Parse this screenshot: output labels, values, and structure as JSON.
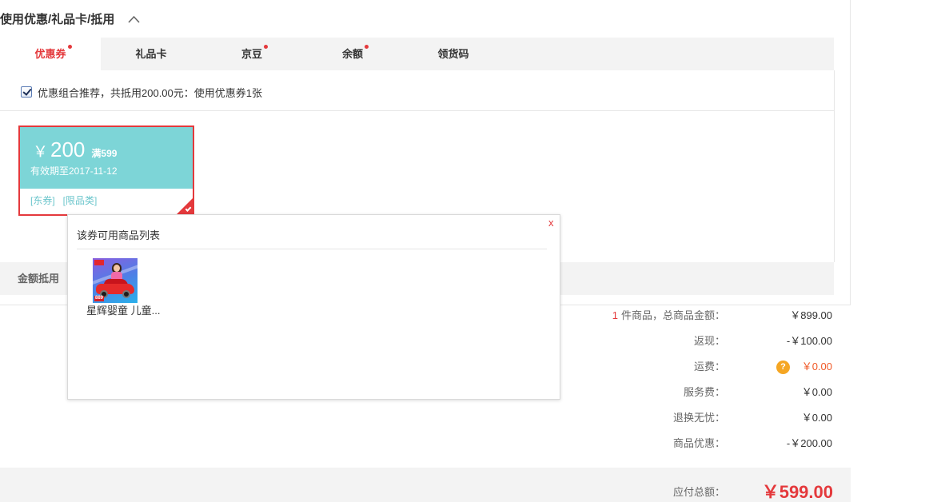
{
  "section": {
    "title": "使用优惠/礼品卡/抵用",
    "toggle_icon": "chevron-up-icon"
  },
  "tabs": [
    {
      "label": "优惠券",
      "active": true,
      "has_dot": true
    },
    {
      "label": "礼品卡",
      "active": false,
      "has_dot": false
    },
    {
      "label": "京豆",
      "active": false,
      "has_dot": true
    },
    {
      "label": "余额",
      "active": false,
      "has_dot": true
    },
    {
      "label": "领货码",
      "active": false,
      "has_dot": false
    }
  ],
  "recommend": {
    "checked": true,
    "text": "优惠组合推荐，共抵用200.00元：使用优惠券1张"
  },
  "coupon": {
    "currency": "￥",
    "amount": "200",
    "threshold": "满599",
    "expiry": "有效期至2017-11-12",
    "tags": [
      "[东券]",
      "[限品类]"
    ],
    "selected": true,
    "selected_icon": "check-corner-icon"
  },
  "amount_bar": {
    "label": "金额抵用"
  },
  "popup": {
    "title": "该券可用商品列表",
    "close_label": "x",
    "products": [
      {
        "name": "星辉婴童 儿童...",
        "image_icon": "kids-ride-on-car-image",
        "image_text": "889"
      }
    ]
  },
  "summary": {
    "item_count": "1",
    "rows": [
      {
        "label": "件商品，总商品金额：",
        "value": "￥899.00"
      },
      {
        "label": "返现：",
        "value": "-￥100.00"
      },
      {
        "label": "运费：",
        "value": "￥0.00",
        "help_icon": "question-circle-icon",
        "help_glyph": "?"
      },
      {
        "label": "服务费：",
        "value": "￥0.00"
      },
      {
        "label": "退换无忧：",
        "value": "￥0.00"
      },
      {
        "label": "商品优惠：",
        "value": "-￥200.00"
      }
    ]
  },
  "total": {
    "label": "应付总额：",
    "value": "￥599.00"
  },
  "colors": {
    "accent": "#e4393c",
    "coupon_bg": "#7dd5d7",
    "coupon_tag": "#6cc6cc",
    "bar_bg": "#f3f3f3",
    "help_icon": "#f5a623",
    "shipping_value": "#f05a28"
  }
}
